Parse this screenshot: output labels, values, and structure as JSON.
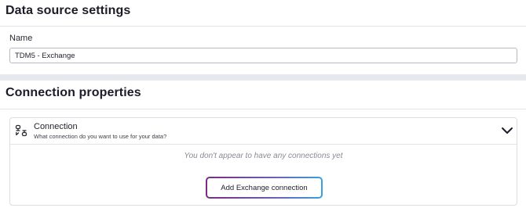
{
  "data_source_settings": {
    "title": "Data source settings",
    "name_label": "Name",
    "name_value": "TDM5 - Exchange"
  },
  "connection_properties": {
    "title": "Connection properties",
    "connection": {
      "icon": "connection-icon",
      "title": "Connection",
      "subtitle": "What connection do you want to use for your data?",
      "expand_icon": "chevron-down-icon",
      "empty_message": "You don't appear to have any connections yet",
      "add_button_label": "Add Exchange connection"
    }
  },
  "colors": {
    "button_border_gradient": [
      "#7a2a83",
      "#6b5bb5",
      "#3aa2d6"
    ],
    "band": "#e7e7ee"
  }
}
